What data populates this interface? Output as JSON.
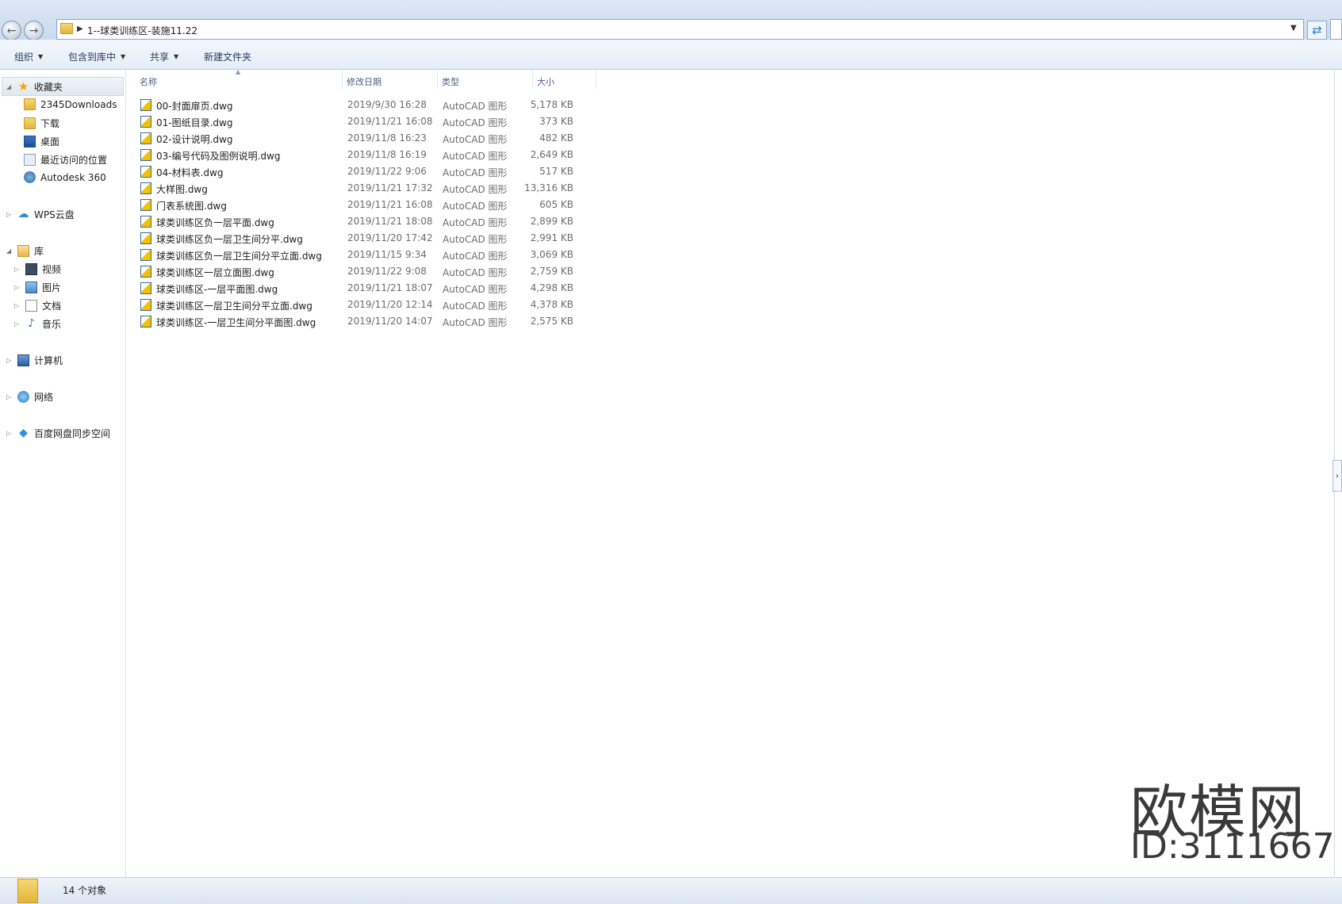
{
  "addressbar": {
    "path": "1--球类训练区-装施11.22",
    "back_icon": "back-arrow-icon",
    "forward_icon": "forward-arrow-icon",
    "refresh_icon": "refresh-icon"
  },
  "toolbar": {
    "organize": "组织",
    "include_in_library": "包含到库中",
    "share": "共享",
    "new_folder": "新建文件夹"
  },
  "nav": {
    "favorites": "收藏夹",
    "fav_items": [
      "2345Downloads",
      "下载",
      "桌面",
      "最近访问的位置",
      "Autodesk 360"
    ],
    "wps_cloud": "WPS云盘",
    "libraries": "库",
    "lib_items": [
      "视频",
      "图片",
      "文档",
      "音乐"
    ],
    "computer": "计算机",
    "network": "网络",
    "baidu": "百度网盘同步空间"
  },
  "columns": {
    "name": "名称",
    "date": "修改日期",
    "type": "类型",
    "size": "大小"
  },
  "files": [
    {
      "name": "00-封面扉页.dwg",
      "date": "2019/9/30 16:28",
      "type": "AutoCAD 图形",
      "size": "5,178 KB"
    },
    {
      "name": "01-图纸目录.dwg",
      "date": "2019/11/21 16:08",
      "type": "AutoCAD 图形",
      "size": "373 KB"
    },
    {
      "name": "02-设计说明.dwg",
      "date": "2019/11/8 16:23",
      "type": "AutoCAD 图形",
      "size": "482 KB"
    },
    {
      "name": "03-编号代码及图例说明.dwg",
      "date": "2019/11/8 16:19",
      "type": "AutoCAD 图形",
      "size": "2,649 KB"
    },
    {
      "name": "04-材料表.dwg",
      "date": "2019/11/22 9:06",
      "type": "AutoCAD 图形",
      "size": "517 KB"
    },
    {
      "name": "大样图.dwg",
      "date": "2019/11/21 17:32",
      "type": "AutoCAD 图形",
      "size": "13,316 KB"
    },
    {
      "name": "门表系统图.dwg",
      "date": "2019/11/21 16:08",
      "type": "AutoCAD 图形",
      "size": "605 KB"
    },
    {
      "name": "球类训练区负一层平面.dwg",
      "date": "2019/11/21 18:08",
      "type": "AutoCAD 图形",
      "size": "2,899 KB"
    },
    {
      "name": "球类训练区负一层卫生间分平.dwg",
      "date": "2019/11/20 17:42",
      "type": "AutoCAD 图形",
      "size": "2,991 KB"
    },
    {
      "name": "球类训练区负一层卫生间分平立面.dwg",
      "date": "2019/11/15 9:34",
      "type": "AutoCAD 图形",
      "size": "3,069 KB"
    },
    {
      "name": "球类训练区一层立面图.dwg",
      "date": "2019/11/22 9:08",
      "type": "AutoCAD 图形",
      "size": "2,759 KB"
    },
    {
      "name": "球类训练区-一层平面图.dwg",
      "date": "2019/11/21 18:07",
      "type": "AutoCAD 图形",
      "size": "4,298 KB"
    },
    {
      "name": "球类训练区一层卫生间分平立面.dwg",
      "date": "2019/11/20 12:14",
      "type": "AutoCAD 图形",
      "size": "4,378 KB"
    },
    {
      "name": "球类训练区-一层卫生间分平面图.dwg",
      "date": "2019/11/20 14:07",
      "type": "AutoCAD 图形",
      "size": "2,575 KB"
    }
  ],
  "status": {
    "count": "14 个对象"
  },
  "watermark": {
    "brand": "欧模网",
    "id": "ID:3111667"
  }
}
